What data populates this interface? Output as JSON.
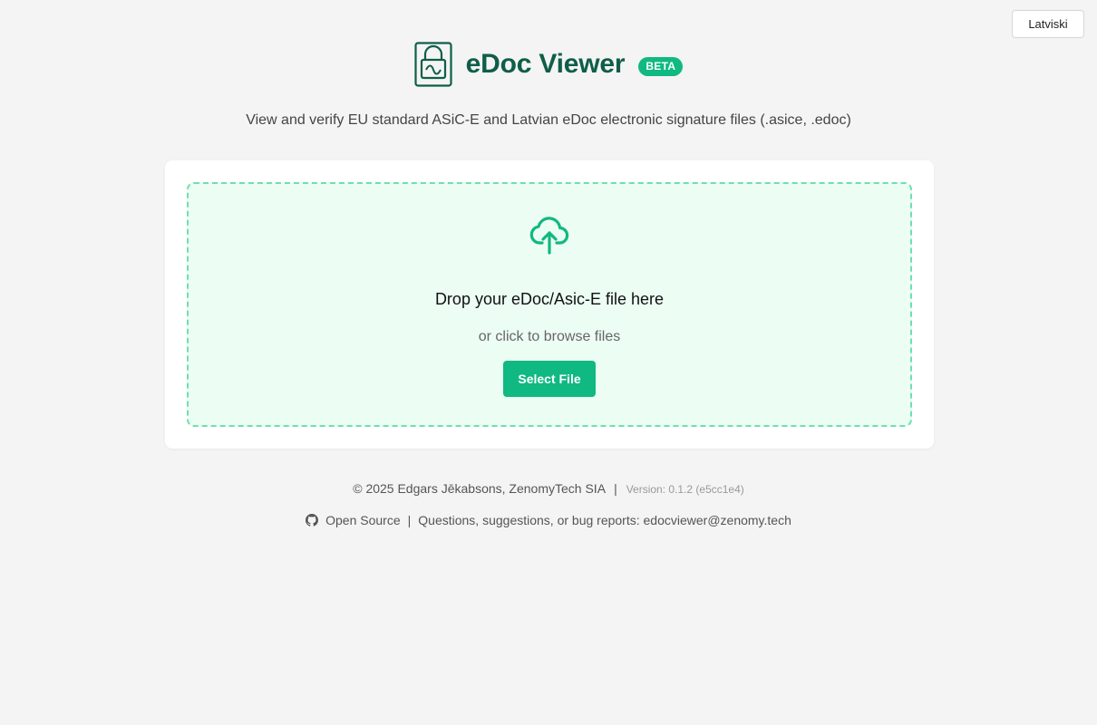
{
  "language_toggle": {
    "label": "Latviski"
  },
  "header": {
    "title": "eDoc Viewer",
    "badge": "BETA",
    "logo_icon": "document-lock-icon"
  },
  "subtitle": "View and verify EU standard ASiC-E and Latvian eDoc electronic signature files (.asice, .edoc)",
  "dropzone": {
    "icon": "cloud-upload-icon",
    "primary_text": "Drop your eDoc/Asic-E file here",
    "secondary_text": "or click to browse files",
    "button_label": "Select File"
  },
  "footer": {
    "copyright": "© 2025 Edgars Jēkabsons, ZenomyTech SIA",
    "separator": "|",
    "version": "Version: 0.1.2 (e5cc1e4)",
    "github_icon": "github-icon",
    "open_source_label": "Open Source",
    "contact_text": "Questions, suggestions, or bug reports: edocviewer@zenomy.tech"
  },
  "colors": {
    "brand_dark": "#0f5e47",
    "accent": "#10b981",
    "dropzone_bg": "#ecfdf4",
    "dropzone_border": "#6ee0b0",
    "page_bg": "#f4f4f4"
  }
}
